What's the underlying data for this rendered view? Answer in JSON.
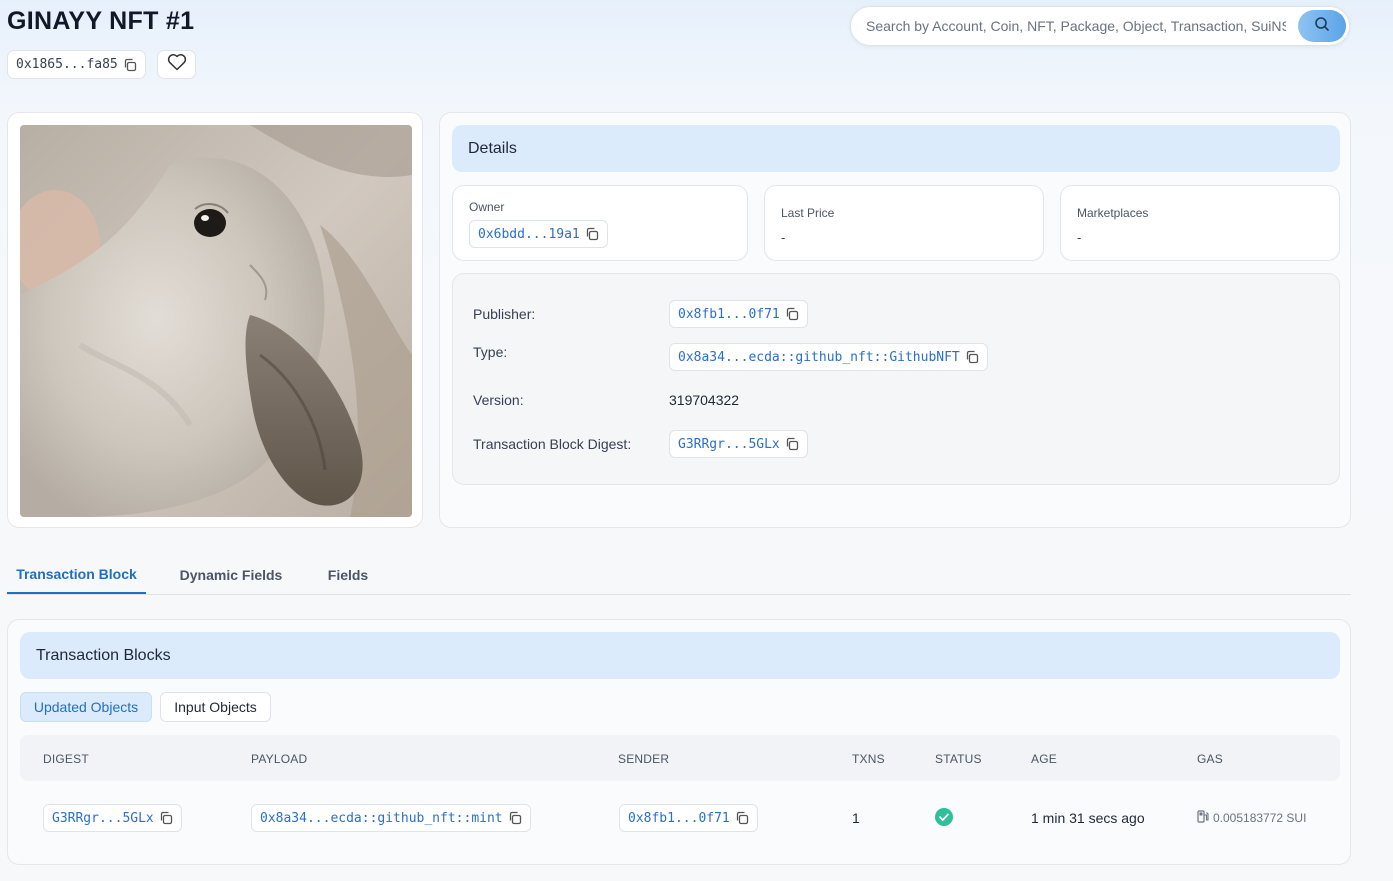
{
  "page": {
    "title": "GINAYY NFT #1",
    "object_id": "0x1865...fa85"
  },
  "search": {
    "placeholder": "Search by Account, Coin, NFT, Package, Object, Transaction, SuiNS"
  },
  "details": {
    "header": "Details",
    "owner": {
      "label": "Owner",
      "value": "0x6bdd...19a1"
    },
    "last_price": {
      "label": "Last Price",
      "value": "-"
    },
    "marketplaces": {
      "label": "Marketplaces",
      "value": "-"
    },
    "publisher": {
      "label": "Publisher:",
      "value": "0x8fb1...0f71"
    },
    "type": {
      "label": "Type:",
      "value": "0x8a34...ecda::github_nft::GithubNFT"
    },
    "version": {
      "label": "Version:",
      "value": "319704322"
    },
    "digest": {
      "label": "Transaction Block Digest:",
      "value": "G3RRgr...5GLx"
    }
  },
  "tabs": [
    {
      "label": "Transaction Block",
      "active": true
    },
    {
      "label": "Dynamic Fields",
      "active": false
    },
    {
      "label": "Fields",
      "active": false
    }
  ],
  "transactions": {
    "header": "Transaction Blocks",
    "filters": [
      {
        "label": "Updated Objects",
        "active": true
      },
      {
        "label": "Input Objects",
        "active": false
      }
    ],
    "columns": [
      "DIGEST",
      "PAYLOAD",
      "SENDER",
      "TXNS",
      "STATUS",
      "AGE",
      "GAS"
    ],
    "rows": [
      {
        "digest": "G3RRgr...5GLx",
        "payload": "0x8a34...ecda::github_nft::mint",
        "sender": "0x8fb1...0f71",
        "txns": "1",
        "status": "success",
        "age": "1 min 31 secs ago",
        "gas": "0.005183772 SUI"
      }
    ]
  },
  "colors": {
    "accent": "#1f6fc5",
    "link": "#2a6fc9",
    "header_bg": "#dcebfb",
    "success": "#2fbf9a"
  },
  "icons": [
    "copy-icon",
    "heart-icon",
    "search-icon",
    "check-circle-icon",
    "gas-pump-icon"
  ]
}
